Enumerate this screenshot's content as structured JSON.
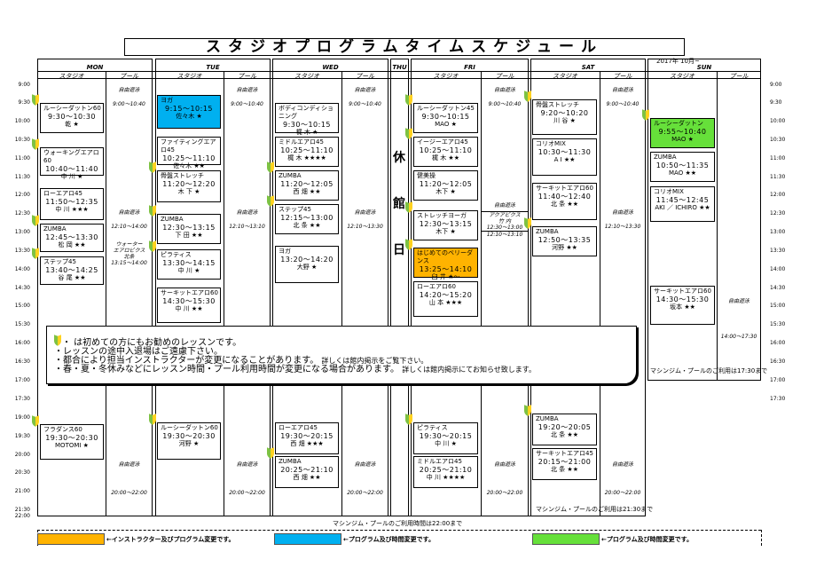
{
  "title": "スタジオプログラムタイムスケジュール",
  "month": "2017年 10月~",
  "days": [
    {
      "name": "MON",
      "studio": "スタジオ",
      "pool": "プール"
    },
    {
      "name": "TUE",
      "studio": "スタジオ",
      "pool": "プール"
    },
    {
      "name": "WED",
      "studio": "スタジオ",
      "pool": "プール"
    },
    {
      "name": "THU"
    },
    {
      "name": "FRI",
      "studio": "スタジオ",
      "pool": "プール"
    },
    {
      "name": "SAT",
      "studio": "スタジオ",
      "pool": "プール"
    },
    {
      "name": "SUN",
      "studio": "スタジオ",
      "pool": "プール"
    }
  ],
  "times": [
    "9:00",
    "9:30",
    "10:00",
    "10:30",
    "11:00",
    "11:30",
    "12:00",
    "12:30",
    "13:00",
    "13:30",
    "14:00",
    "14:30",
    "15:00",
    "15:30",
    "16:00",
    "16:30",
    "17:00",
    "17:30",
    "19:00",
    "19:30",
    "20:00",
    "20:30",
    "21:00",
    "21:30",
    "22:00"
  ],
  "closed": [
    "休",
    "館",
    "日"
  ],
  "classes": {
    "mon": [
      {
        "n": "ルーシーダットン60",
        "t": "9:30～10:30",
        "i": "乾 ★"
      },
      {
        "n": "ウォーキングエアロ60",
        "t": "10:40～11:40",
        "i": "中 川 ★"
      },
      {
        "n": "ローエアロ45",
        "t": "11:50～12:35",
        "i": "中 川 ★★★"
      },
      {
        "n": "ZUMBA",
        "t": "12:45～13:30",
        "i": "松 岡 ★★"
      },
      {
        "n": "ステップ45",
        "t": "13:40～14:25",
        "i": "谷 尾 ★★"
      },
      {
        "n": "フラダンス60",
        "t": "19:30～20:30",
        "i": "MOTOMI ★"
      }
    ],
    "tue": [
      {
        "n": "ヨガ",
        "t": "9:15～10:15",
        "i": "佐々木 ★"
      },
      {
        "n": "ファイティングエアロ45",
        "t": "10:25～11:10",
        "i": "佐々木 ★★"
      },
      {
        "n": "骨盤ストレッチ",
        "t": "11:20～12:20",
        "i": "木 下 ★"
      },
      {
        "n": "ZUMBA",
        "t": "12:30～13:15",
        "i": "下 田 ★★"
      },
      {
        "n": "ピラティス",
        "t": "13:30～14:15",
        "i": "中 川 ★"
      },
      {
        "n": "サーキットエアロ60",
        "t": "14:30～15:30",
        "i": "中 川 ★★"
      },
      {
        "n": "ルーシーダットン60",
        "t": "19:30～20:30",
        "i": "河野 ★"
      }
    ],
    "wed": [
      {
        "n": "ボディコンディショニング",
        "t": "9:30～10:15",
        "i": "梶 木 ★"
      },
      {
        "n": "ミドルエアロ45",
        "t": "10:25～11:10",
        "i": "梶 木 ★★★★"
      },
      {
        "n": "ZUMBA",
        "t": "11:20～12:05",
        "i": "西 畑 ★★"
      },
      {
        "n": "ステップ45",
        "t": "12:15～13:00",
        "i": "北 条 ★★"
      },
      {
        "n": "ヨガ",
        "t": "13:20～14:20",
        "i": "大野 ★"
      },
      {
        "n": "ローエアロ45",
        "t": "19:30～20:15",
        "i": "西 畑 ★★★"
      },
      {
        "n": "ZUMBA",
        "t": "20:25～21:10",
        "i": "西 畑 ★★"
      }
    ],
    "fri": [
      {
        "n": "ルーシーダットン45",
        "t": "9:30～10:15",
        "i": "MAO ★"
      },
      {
        "n": "イージーエアロ45",
        "t": "10:25～11:10",
        "i": "梶 木 ★★"
      },
      {
        "n": "健美操",
        "t": "11:20～12:05",
        "i": "木下 ★"
      },
      {
        "n": "ストレッチヨーガ",
        "t": "12:30～13:15",
        "i": "木下 ★"
      },
      {
        "n": "はじめてのベリーダンス",
        "t": "13:25～14:10",
        "i": "臼 井 ★～"
      },
      {
        "n": "ローエアロ60",
        "t": "14:20～15:20",
        "i": "山 本 ★★★"
      },
      {
        "n": "ピラティス",
        "t": "19:30～20:15",
        "i": "中 川 ★"
      },
      {
        "n": "ミドルエアロ45",
        "t": "20:25～21:10",
        "i": "中 川 ★★★★"
      }
    ],
    "sat": [
      {
        "n": "骨盤ストレッチ",
        "t": "9:20～10:20",
        "i": "川 谷 ★"
      },
      {
        "n": "コリオMIX",
        "t": "10:30～11:30",
        "i": "A I ★★"
      },
      {
        "n": "サーキットエアロ60",
        "t": "11:40～12:40",
        "i": "北 条 ★★"
      },
      {
        "n": "ZUMBA",
        "t": "12:50～13:35",
        "i": "河野 ★★"
      },
      {
        "n": "ZUMBA",
        "t": "19:20～20:05",
        "i": "北 条 ★★"
      },
      {
        "n": "サーキットエアロ45",
        "t": "20:15～21:00",
        "i": "北 条 ★★"
      }
    ],
    "sun": [
      {
        "n": "ルーシーダットン",
        "t": "9:55～10:40",
        "i": "MAO ★"
      },
      {
        "n": "ZUMBA",
        "t": "10:50～11:35",
        "i": "MAO ★★"
      },
      {
        "n": "コリオMIX",
        "t": "11:45～12:45",
        "i": "AKI ／ ICHIRO ★★"
      },
      {
        "n": "サーキットエアロ60",
        "t": "14:30～15:30",
        "i": "坂本 ★★"
      }
    ]
  },
  "pool": {
    "free": "自由遊泳",
    "mon1": "9:00～10:40",
    "mon2": "12:10～14:00",
    "mon3": "ウォーター",
    "mon4": "エアロビクス",
    "mon5": "北条",
    "mon6": "13:15～14:00",
    "mon7": "20:00～22:00",
    "tue1": "9:00～10:40",
    "tue2": "12:10～13:10",
    "tue3": "20:00～22:00",
    "wed1": "9:00～10:40",
    "wed2": "12:10～13:30",
    "wed3": "20:00～22:00",
    "fri1": "9:00～10:40",
    "fri2": "アクアビクス",
    "fri3": "竹 内",
    "fri4": "12:30～13:00",
    "fri5": "12:10～13:10",
    "fri6": "20:00～22:00",
    "sat1": "9:00～10:40",
    "sat2": "12:10～13:30",
    "sat3": "20:00～22:00",
    "sun1": "14:00～17:30"
  },
  "notice": [
    "・ は初めての方にもお勧めのレッスンです。",
    "・レッスンの途中入退場はご遠慮下さい。",
    "・都合により担当インストラクターが変更になることがあります。",
    "詳しくは館内掲示をご覧下さい。",
    "・春・夏・冬休みなどにレッスン時間・プール利用時間が変更になる場合があります。",
    "詳しくは館内掲示にてお知らせ致します。"
  ],
  "footer": {
    "sunNote": "マシンジム・プールのご利用は17:30まで",
    "satNote": "マシンジム・プールのご利用は21:30まで",
    "allNote": "マシンジム・プールのご利用時間は22:00まで"
  },
  "legend": [
    {
      "color": "#ffb300",
      "label": "←インストラクター及びプログラム変更です。"
    },
    {
      "color": "#00b0f0",
      "label": "←プログラム及び時間変更です。"
    },
    {
      "color": "#66e03a",
      "label": "←プログラム及び時間変更です。"
    }
  ],
  "highlights": {
    "orange": "#ffb300",
    "blue": "#00b0f0",
    "green": "#66e03a"
  }
}
